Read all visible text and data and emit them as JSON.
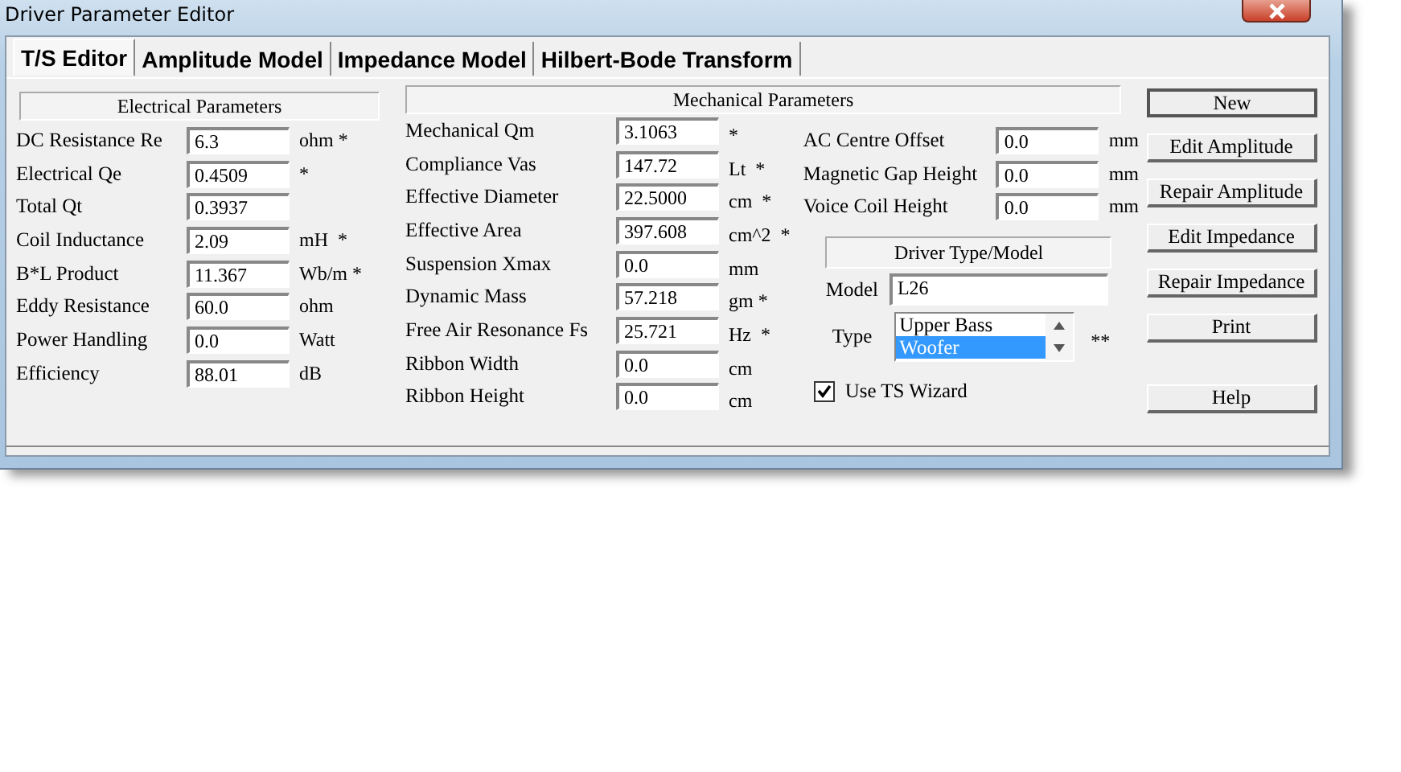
{
  "window": {
    "title": "Driver Parameter Editor"
  },
  "tabs": [
    {
      "label": "T/S Editor",
      "selected": true
    },
    {
      "label": "Amplitude Model",
      "selected": false
    },
    {
      "label": "Impedance Model",
      "selected": false
    },
    {
      "label": "Hilbert-Bode Transform",
      "selected": false
    }
  ],
  "electrical": {
    "title": "Electrical Parameters",
    "rows": [
      {
        "label": "DC Resistance Re",
        "value": "6.3",
        "unit": "ohm *"
      },
      {
        "label": "Electrical Qe",
        "value": "0.4509",
        "unit": "*"
      },
      {
        "label": "Total Qt",
        "value": "0.3937"
      },
      {
        "label": "Coil Inductance",
        "value": "2.09",
        "unit": "mH  *"
      },
      {
        "label": "B*L Product",
        "value": "11.367",
        "unit": "Wb/m *"
      },
      {
        "label": "Eddy Resistance",
        "value": "60.0",
        "unit": "ohm"
      },
      {
        "label": "Power Handling",
        "value": "0.0",
        "unit": "Watt"
      },
      {
        "label": "Efficiency",
        "value": "88.01",
        "unit": "dB"
      }
    ]
  },
  "mechanical": {
    "title": "Mechanical Parameters",
    "rows": [
      {
        "label": "Mechanical Qm",
        "value": "3.1063",
        "unit": "*"
      },
      {
        "label": "Compliance Vas",
        "value": "147.72",
        "unit": "Lt  *"
      },
      {
        "label": "Effective Diameter",
        "value": "22.5000",
        "unit": "cm  *"
      },
      {
        "label": "Effective Area",
        "value": "397.608",
        "unit": "cm^2  *"
      },
      {
        "label": "Suspension Xmax",
        "value": "0.0",
        "unit": "mm"
      },
      {
        "label": "Dynamic Mass",
        "value": "57.218",
        "unit": "gm *"
      },
      {
        "label": "Free Air Resonance Fs",
        "value": "25.721",
        "unit": "Hz  *"
      },
      {
        "label": "Ribbon Width",
        "value": "0.0",
        "unit": "cm"
      },
      {
        "label": "Ribbon Height",
        "value": "0.0",
        "unit": "cm"
      }
    ],
    "extra_rows": [
      {
        "label": "AC Centre Offset",
        "value": "0.0",
        "unit": "mm"
      },
      {
        "label": "Magnetic Gap Height",
        "value": "0.0",
        "unit": "mm"
      },
      {
        "label": "Voice Coil Height",
        "value": "0.0",
        "unit": "mm"
      }
    ]
  },
  "driver": {
    "title": "Driver Type/Model",
    "model_label": "Model",
    "model": "L26",
    "type_label": "Type",
    "types": [
      {
        "label": "Upper Bass",
        "selected": false
      },
      {
        "label": "Woofer",
        "selected": true
      }
    ],
    "type_note": "**"
  },
  "wizard": {
    "label": "Use TS Wizard",
    "checked": true
  },
  "buttons": [
    "New",
    "Edit Amplitude",
    "Repair Amplitude",
    "Edit Impedance",
    "Repair Impedance",
    "Print",
    "Help"
  ]
}
